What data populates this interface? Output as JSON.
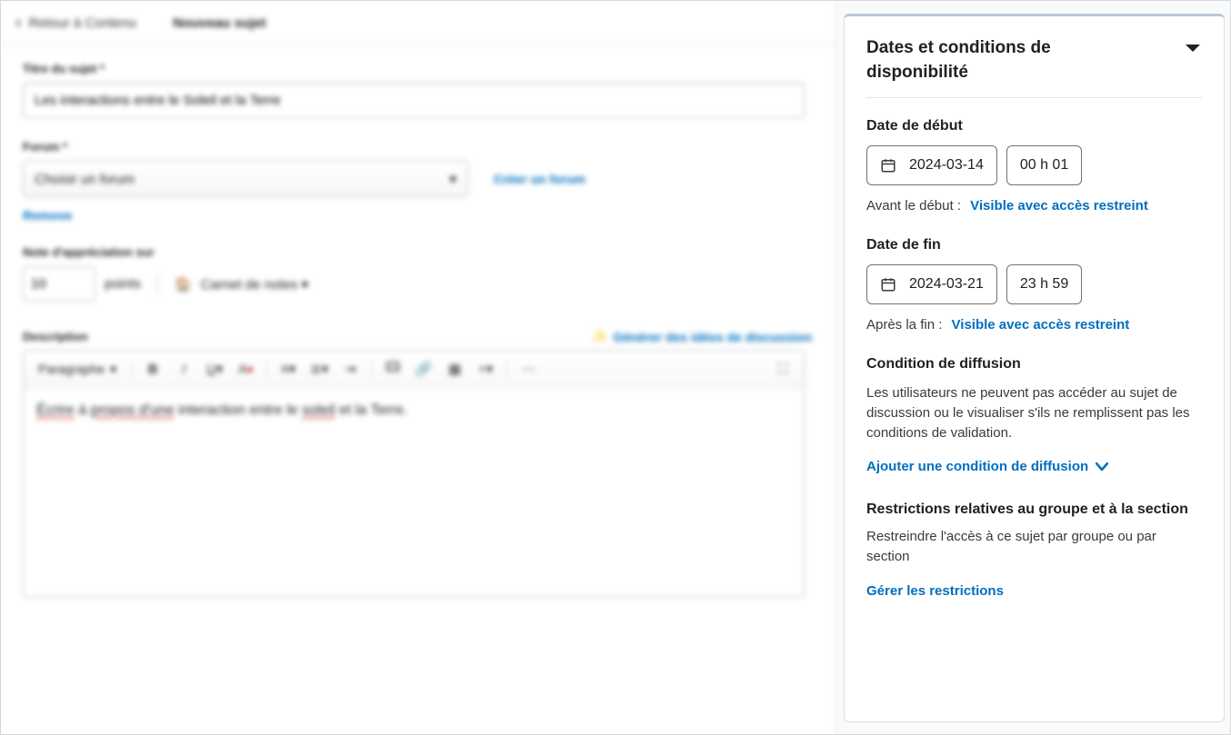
{
  "header": {
    "back_label": "Retour à Contenu",
    "title": "Nouveau sujet"
  },
  "main": {
    "title_label": "Titre du sujet *",
    "title_value": "Les interactions entre le Soleil et la Terre",
    "forum_label": "Forum *",
    "forum_placeholder": "Choisir un forum",
    "create_forum_label": "Créer un forum",
    "remove_label": "Remove",
    "grade_label": "Note d'appréciation sur",
    "points_value": "10",
    "points_unit": "points",
    "not_in_gradebook": "Carnet de notes ▾",
    "description_label": "Description",
    "generate_ideas": "Générer des idées de discussion",
    "paragraph_style": "Paragraphe",
    "editor_text_pre": "Écrire",
    "editor_text_mid1": " à ",
    "editor_text_u1": "propos d'une",
    "editor_text_mid2": " interaction entre le ",
    "editor_text_u2": "soleil",
    "editor_text_end": " et la Terre."
  },
  "sidebar": {
    "panel_title": "Dates et conditions de disponibilité",
    "start_label": "Date de début",
    "start_date": "2024-03-14",
    "start_time": "00 h 01",
    "before_start_label": "Avant le début :",
    "before_start_value": "Visible avec accès restreint",
    "end_label": "Date de fin",
    "end_date": "2024-03-21",
    "end_time": "23 h 59",
    "after_end_label": "Après la fin :",
    "after_end_value": "Visible avec accès restreint",
    "release_title": "Condition de diffusion",
    "release_para": "Les utilisateurs ne peuvent pas accéder au sujet de discussion ou le visualiser s'ils ne remplissent pas les conditions de validation.",
    "add_release": "Ajouter une condition de diffusion",
    "group_title": "Restrictions relatives au groupe et à la section",
    "group_para": "Restreindre l'accès à ce sujet par groupe ou par section",
    "manage_restrictions": "Gérer les restrictions"
  }
}
